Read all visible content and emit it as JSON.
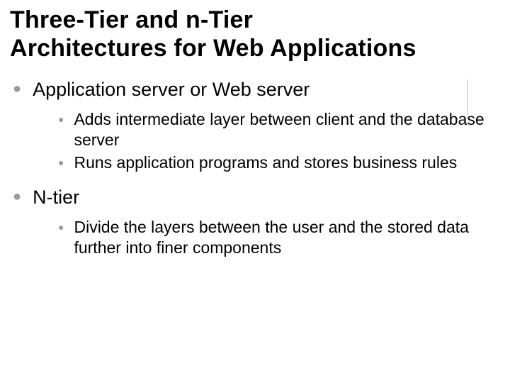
{
  "title": {
    "line1": "Three-Tier and n-Tier",
    "line2": "Architectures for Web Applications"
  },
  "items": [
    {
      "text": "Application server or Web server",
      "sub": [
        "Adds intermediate layer between client and the database server",
        "Runs application programs and stores business rules"
      ]
    },
    {
      "text": "N-tier",
      "sub": [
        "Divide the layers between the user and the stored data further into finer components"
      ]
    }
  ]
}
